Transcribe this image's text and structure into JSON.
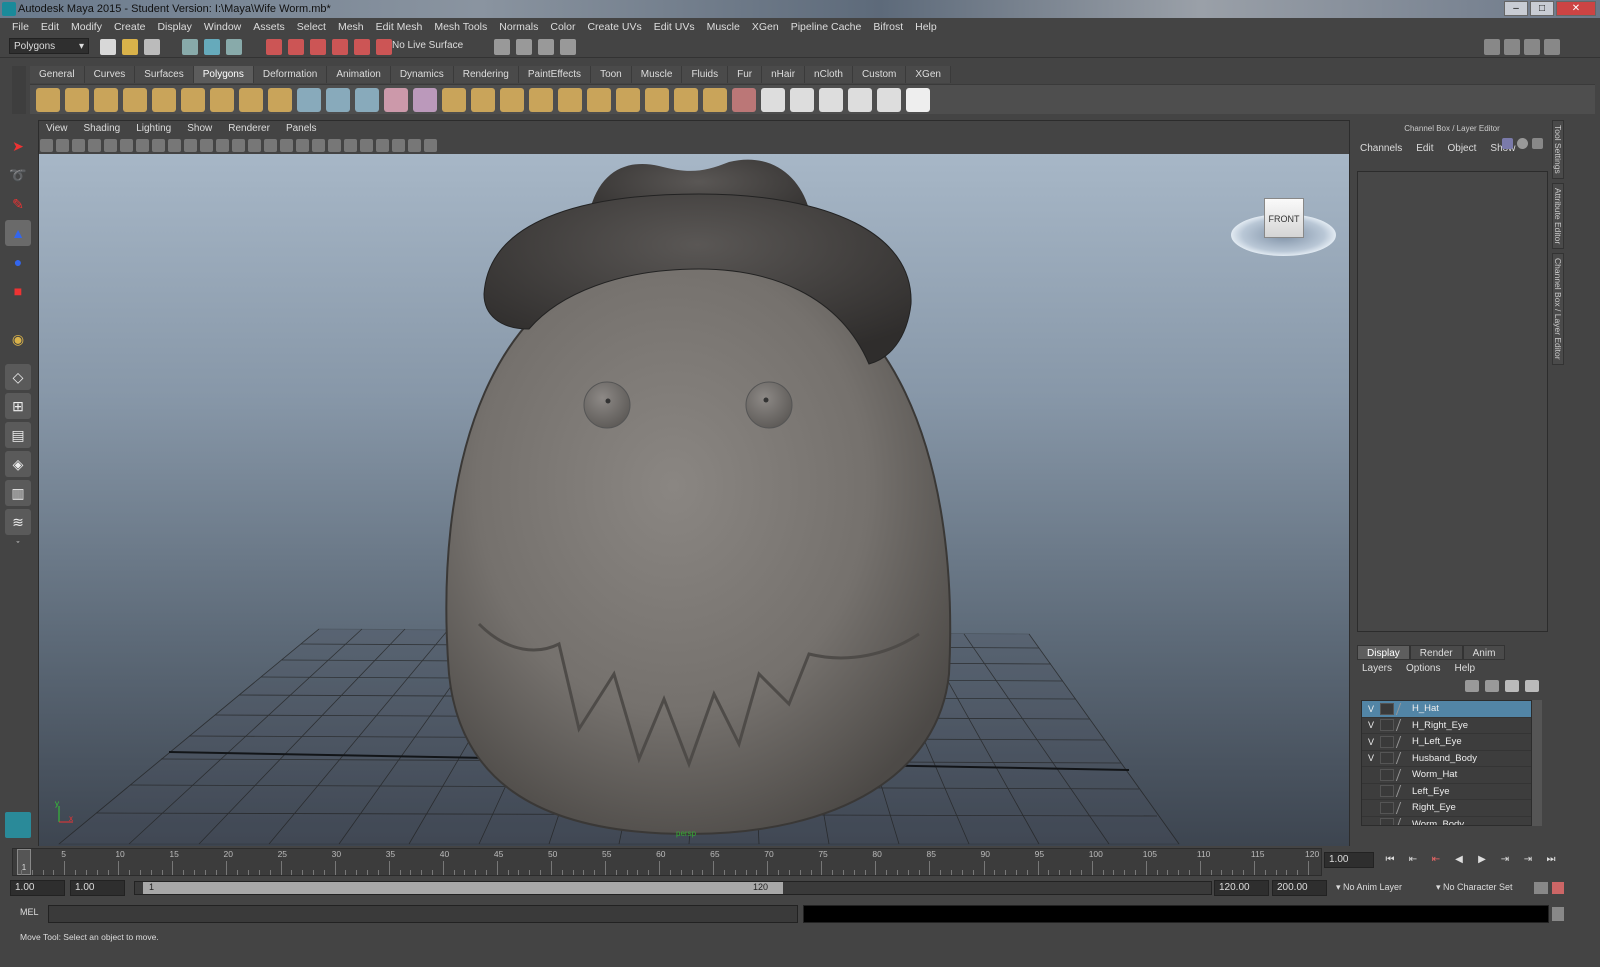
{
  "window": {
    "title": "Autodesk Maya 2015 - Student Version: I:\\Maya\\Wife Worm.mb*",
    "buttons": [
      "–",
      "□",
      "✕"
    ]
  },
  "menubar": [
    "File",
    "Edit",
    "Modify",
    "Create",
    "Display",
    "Window",
    "Assets",
    "Select",
    "Mesh",
    "Edit Mesh",
    "Mesh Tools",
    "Normals",
    "Color",
    "Create UVs",
    "Edit UVs",
    "Muscle",
    "XGen",
    "Pipeline Cache",
    "Bifrost",
    "Help"
  ],
  "status_line": {
    "mode_dropdown": "Polygons",
    "live_surface": "No Live Surface"
  },
  "shelf_tabs": [
    "General",
    "Curves",
    "Surfaces",
    "Polygons",
    "Deformation",
    "Animation",
    "Dynamics",
    "Rendering",
    "PaintEffects",
    "Toon",
    "Muscle",
    "Fluids",
    "Fur",
    "nHair",
    "nCloth",
    "Custom",
    "XGen"
  ],
  "shelf_active": "Polygons",
  "panel_menu": [
    "View",
    "Shading",
    "Lighting",
    "Show",
    "Renderer",
    "Panels"
  ],
  "viewcube_label": "FRONT",
  "viewport_camera_label": "persp",
  "axis": {
    "x": "x",
    "y": "y"
  },
  "channel_box": {
    "title": "Channel Box / Layer Editor",
    "menu": [
      "Channels",
      "Edit",
      "Object",
      "Show"
    ]
  },
  "layer_editor": {
    "tabs": [
      "Display",
      "Render",
      "Anim"
    ],
    "active_tab": "Display",
    "menu": [
      "Layers",
      "Options",
      "Help"
    ],
    "layers": [
      {
        "name": "H_Hat",
        "visible": "V",
        "selected": true
      },
      {
        "name": "H_Right_Eye",
        "visible": "V",
        "selected": false
      },
      {
        "name": "H_Left_Eye",
        "visible": "V",
        "selected": false
      },
      {
        "name": "Husband_Body",
        "visible": "V",
        "selected": false
      },
      {
        "name": "Worm_Hat",
        "visible": "",
        "selected": false
      },
      {
        "name": "Left_Eye",
        "visible": "",
        "selected": false
      },
      {
        "name": "Right_Eye",
        "visible": "",
        "selected": false
      },
      {
        "name": "Worm_Body",
        "visible": "",
        "selected": false
      }
    ]
  },
  "side_tabs": [
    "Tool Settings",
    "Attribute Editor",
    "Channel Box / Layer Editor"
  ],
  "timeline": {
    "ticks": [
      "5",
      "10",
      "15",
      "20",
      "25",
      "30",
      "35",
      "40",
      "45",
      "50",
      "55",
      "60",
      "65",
      "70",
      "75",
      "80",
      "85",
      "90",
      "95",
      "100",
      "105",
      "110",
      "115",
      "120"
    ],
    "current_frame_marker": "1",
    "current_frame_field": "1.00"
  },
  "range_slider": {
    "start_time": "1.00",
    "playback_start": "1.00",
    "slider_start": "1",
    "slider_end": "120",
    "playback_end": "120.00",
    "end_time": "200.00",
    "anim_layer": "No Anim Layer",
    "character_set": "No Character Set"
  },
  "command_line": {
    "label": "MEL"
  },
  "help_line": "Move Tool: Select an object to move."
}
